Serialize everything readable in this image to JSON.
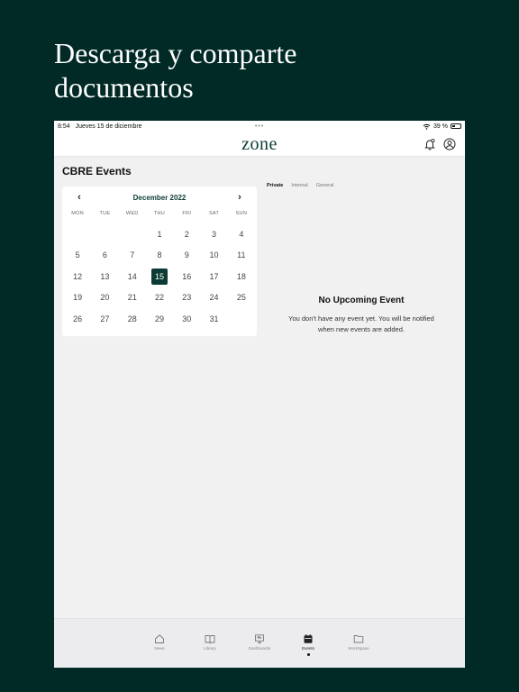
{
  "headline": {
    "line1": "Descarga y comparte",
    "line2": "documentos"
  },
  "status": {
    "time": "8:54",
    "date": "Jueves 15 de diciembre",
    "dots": "•••",
    "battery": "39 %"
  },
  "app": {
    "logo": "zone"
  },
  "page": {
    "title": "CBRE Events"
  },
  "calendar": {
    "month": "December 2022",
    "prev": "‹",
    "next": "›",
    "weekdays": [
      "MON",
      "TUE",
      "WED",
      "THU",
      "FRI",
      "SAT",
      "SUN"
    ],
    "days": [
      "",
      "",
      "",
      "1",
      "2",
      "3",
      "4",
      "5",
      "6",
      "7",
      "8",
      "9",
      "10",
      "11",
      "12",
      "13",
      "14",
      "15",
      "16",
      "17",
      "18",
      "19",
      "20",
      "21",
      "22",
      "23",
      "24",
      "25",
      "26",
      "27",
      "28",
      "29",
      "30",
      "31",
      ""
    ],
    "selected_day": "15"
  },
  "tabs": [
    "Private",
    "Internal",
    "General"
  ],
  "empty": {
    "title": "No Upcoming Event",
    "desc1": "You don't have any event yet. You will be notified",
    "desc2": "when new events are added."
  },
  "tabbar": [
    {
      "label": "News",
      "icon": "home-icon"
    },
    {
      "label": "Library",
      "icon": "book-icon"
    },
    {
      "label": "Dashboards",
      "icon": "dashboard-icon"
    },
    {
      "label": "Events",
      "icon": "calendar-icon",
      "active": true
    },
    {
      "label": "WorkSpace",
      "icon": "folder-icon"
    }
  ],
  "colors": {
    "background": "#012a26",
    "accent": "#0b3b33"
  }
}
